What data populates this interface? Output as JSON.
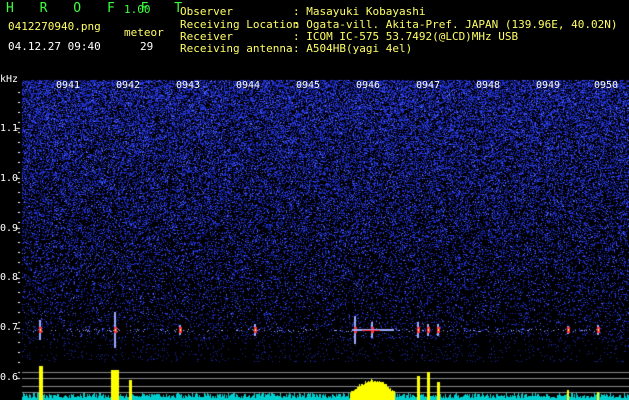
{
  "app": {
    "name": "H R O F F T",
    "version": "1.00"
  },
  "file": {
    "name": "0412270940.png",
    "datetime": "04.12.27 09:40"
  },
  "meteor": {
    "label": "meteor",
    "count": "29"
  },
  "station": {
    "observer_label": "Observer",
    "observer_value": ": Masayuki Kobayashi",
    "location_label": "Receiving Location",
    "location_value": ": Ogata-vill. Akita-Pref. JAPAN (139.96E, 40.02N)",
    "receiver_label": "Receiver",
    "receiver_value": ": ICOM IC-575 53.7492(@LCD)MHz USB",
    "antenna_label": "Receiving antenna",
    "antenna_value": ": A504HB(yagi 4el)"
  },
  "axis": {
    "unit": "kHz",
    "y_ticks": [
      "1.1",
      "1.0",
      "0.9",
      "0.8",
      "0.7",
      "0.6"
    ],
    "x_ticks": [
      "0941",
      "0942",
      "0943",
      "0944",
      "0945",
      "0946",
      "0947",
      "0948",
      "0949",
      "0950"
    ]
  },
  "colors": {
    "noise": "#1d2cc0",
    "echo_line": "#9aa8ff",
    "echo_core": "#ff3040",
    "echo_peak": "#ffff40",
    "level_bar": "#ffff00",
    "level_noise": "#00d0d0"
  }
}
